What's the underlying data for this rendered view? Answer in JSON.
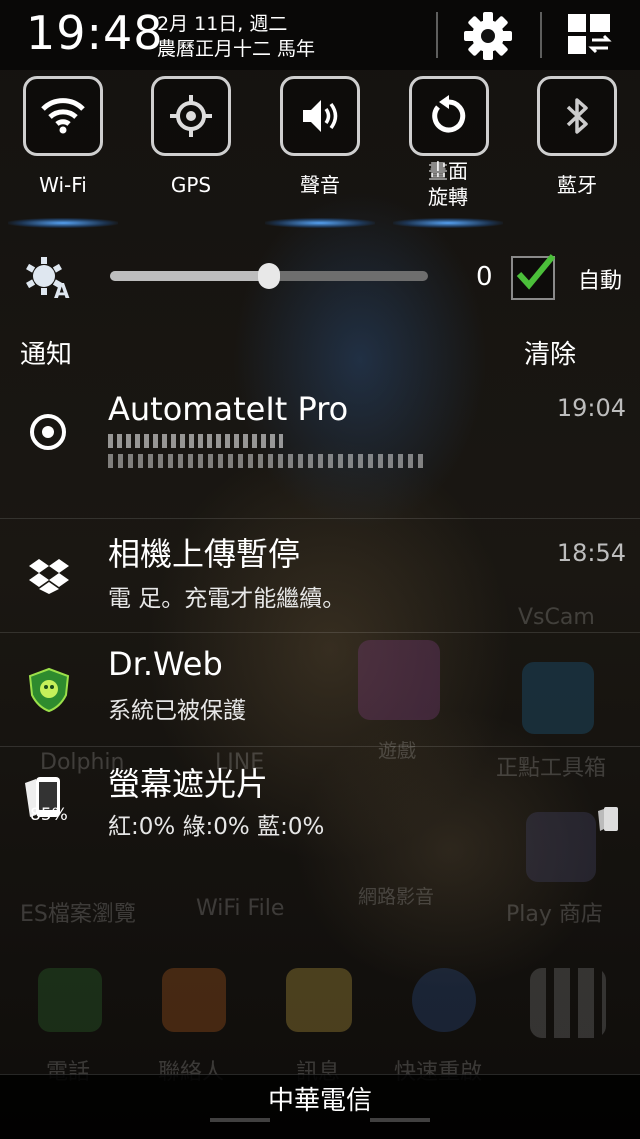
{
  "status": {
    "time": "19:48",
    "date_line1": "2月 11日, 週二",
    "date_line2": "農曆正月十二 馬年"
  },
  "header_buttons": [
    {
      "icon": "gear-icon"
    },
    {
      "icon": "edit-panel-icon"
    }
  ],
  "quick_settings": [
    {
      "label": "Wi-Fi",
      "icon": "wifi-icon",
      "active": true
    },
    {
      "label": "GPS",
      "icon": "gps-icon",
      "active": false
    },
    {
      "label": "聲音",
      "icon": "sound-icon",
      "active": true
    },
    {
      "label": "畫面\n旋轉",
      "icon": "rotate-icon",
      "active": true
    },
    {
      "label": "藍牙",
      "icon": "bluetooth-icon",
      "active": false
    }
  ],
  "brightness": {
    "value": "0",
    "level": 0.5,
    "auto_label": "自動",
    "auto_checked": true
  },
  "notifications_header": {
    "title": "通知",
    "clear": "清除"
  },
  "notifications": [
    {
      "title": "AutomateIt Pro",
      "subtitle": "",
      "time": "19:04",
      "icon": "automateit-icon"
    },
    {
      "title": "相機上傳暫停",
      "subtitle": "電  足。充電才能繼續。",
      "time": "18:54",
      "icon": "dropbox-icon"
    },
    {
      "title": "Dr.Web",
      "subtitle": "系統已被保護",
      "time": "",
      "icon": "drweb-shield-icon"
    },
    {
      "title": "螢幕遮光片",
      "subtitle": "紅:0% 綠:0% 藍:0%",
      "time": "",
      "icon": "screen-filter-icon",
      "badge": "85%"
    }
  ],
  "background_labels": [
    "VsCam",
    "Dolphin",
    "LINE",
    "遊戲",
    "正點工具箱",
    "ES檔案瀏覽",
    "WiFi File",
    "網路影音",
    "Play 商店",
    "電話",
    "聯絡人",
    "訊息",
    "快速重啟"
  ],
  "carrier": "中華電信"
}
